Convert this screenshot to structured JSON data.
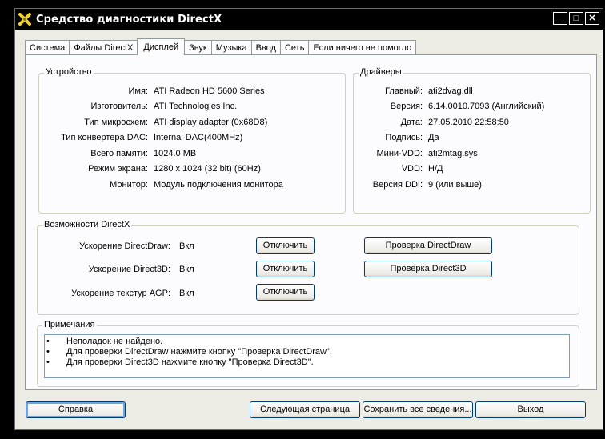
{
  "window": {
    "title": "Средство диагностики DirectX",
    "controls": {
      "minimize": "_",
      "maximize": "□",
      "close": "✕"
    }
  },
  "tabs": [
    {
      "label": "Система"
    },
    {
      "label": "Файлы DirectX"
    },
    {
      "label": "Дисплей",
      "active": true
    },
    {
      "label": "Звук"
    },
    {
      "label": "Музыка"
    },
    {
      "label": "Ввод"
    },
    {
      "label": "Сеть"
    },
    {
      "label": "Если ничего не помогло"
    }
  ],
  "device": {
    "title": "Устройство",
    "rows": [
      {
        "label": "Имя:",
        "value": "ATI Radeon HD 5600 Series"
      },
      {
        "label": "Изготовитель:",
        "value": "ATI Technologies Inc."
      },
      {
        "label": "Тип микросхем:",
        "value": "ATI display adapter (0x68D8)"
      },
      {
        "label": "Тип конвертера DAC:",
        "value": "Internal DAC(400MHz)"
      },
      {
        "label": "Всего памяти:",
        "value": "1024.0 MB"
      },
      {
        "label": "Режим экрана:",
        "value": "1280 x 1024 (32 bit) (60Hz)"
      },
      {
        "label": "Монитор:",
        "value": "Модуль подключения монитора"
      }
    ]
  },
  "drivers": {
    "title": "Драйверы",
    "rows": [
      {
        "label": "Главный:",
        "value": "ati2dvag.dll"
      },
      {
        "label": "Версия:",
        "value": "6.14.0010.7093 (Английский)"
      },
      {
        "label": "Дата:",
        "value": "27.05.2010 22:58:50"
      },
      {
        "label": "Подпись:",
        "value": "Да"
      },
      {
        "label": "Мини-VDD:",
        "value": "ati2mtag.sys"
      },
      {
        "label": "VDD:",
        "value": "Н/Д"
      },
      {
        "label": "Версия DDI:",
        "value": "9 (или выше)"
      }
    ]
  },
  "directx": {
    "title": "Возможности DirectX",
    "rows": [
      {
        "label": "Ускорение DirectDraw:",
        "value": "Вкл",
        "button": "Отключить"
      },
      {
        "label": "Ускорение Direct3D:",
        "value": "Вкл",
        "button": "Отключить"
      },
      {
        "label": "Ускорение текстур AGP:",
        "value": "Вкл",
        "button": "Отключить"
      }
    ],
    "test_directdraw": "Проверка DirectDraw",
    "test_direct3d": "Проверка Direct3D"
  },
  "notes": {
    "title": "Примечания",
    "bullet": "•",
    "items": [
      "Неполадок не найдено.",
      "Для проверки DirectDraw нажмите кнопку \"Проверка DirectDraw\".",
      "Для проверки Direct3D нажмите кнопку \"Проверка Direct3D\"."
    ]
  },
  "footer": {
    "help": "Справка",
    "next_page": "Следующая страница",
    "save_all": "Сохранить все сведения...",
    "exit": "Выход"
  }
}
